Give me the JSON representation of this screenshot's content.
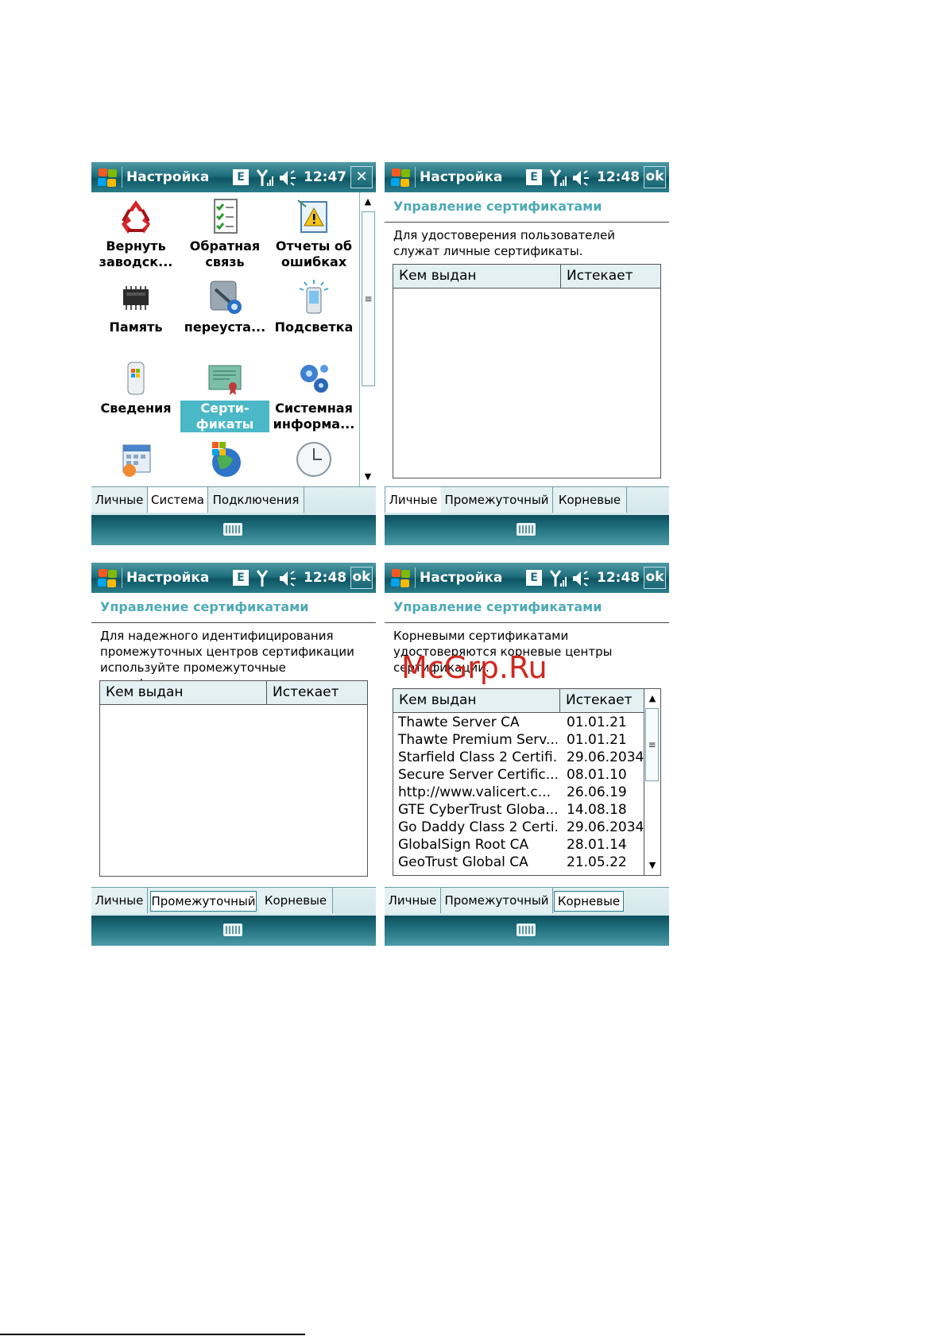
{
  "status": {
    "app_title": "Настройка",
    "network_badge": "E",
    "time_1": "12:47",
    "time_2": "12:48",
    "ok_label": "ok",
    "close_label": "✕"
  },
  "system": {
    "items": [
      {
        "label": "Вернуть заводск...",
        "icon": "recycle-icon"
      },
      {
        "label": "Обратная связь",
        "icon": "checklist-icon"
      },
      {
        "label": "Отчеты об ошибках",
        "icon": "error-report-icon"
      },
      {
        "label": "Память",
        "icon": "memory-chip-icon"
      },
      {
        "label": "переуста...",
        "icon": "reinstall-icon"
      },
      {
        "label": "Подсветка",
        "icon": "backlight-icon"
      },
      {
        "label": "Сведения",
        "icon": "device-info-icon"
      },
      {
        "label": "Серти-фикаты",
        "icon": "certificate-icon"
      },
      {
        "label": "Системная информа...",
        "icon": "system-info-gears-icon"
      },
      {
        "label": "",
        "icon": "calendar-icon"
      },
      {
        "label": "",
        "icon": "windows-globe-icon"
      },
      {
        "label": "",
        "icon": "clock-icon"
      }
    ],
    "tabs": [
      "Личные",
      "Система",
      "Подключения"
    ]
  },
  "certs": {
    "header": "Управление сертификатами",
    "col_issued": "Кем выдан",
    "col_expires": "Истекает",
    "tabs": [
      "Личные",
      "Промежуточный",
      "Корневые"
    ],
    "personal_desc": "Для удостоверения пользователей служат личные сертификаты.",
    "intermediate_desc": "Для надежного идентифицирования промежуточных центров сертификации используйте промежуточные сертификаты.",
    "root_desc": "Корневыми сертификатами удостоверяются корневые центры сертификации.",
    "root_rows": [
      {
        "issuer": "Thawte Server CA",
        "expires": "01.01.21"
      },
      {
        "issuer": "Thawte Premium Serv...",
        "expires": "01.01.21"
      },
      {
        "issuer": "Starfield Class 2 Certifi...",
        "expires": "29.06.2034"
      },
      {
        "issuer": "Secure Server Certific...",
        "expires": "08.01.10"
      },
      {
        "issuer": "http://www.valicert.c...",
        "expires": "26.06.19"
      },
      {
        "issuer": "GTE CyberTrust Globa...",
        "expires": "14.08.18"
      },
      {
        "issuer": "Go Daddy Class 2 Certi...",
        "expires": "29.06.2034"
      },
      {
        "issuer": "GlobalSign Root CA",
        "expires": "28.01.14"
      },
      {
        "issuer": "GeoTrust Global CA",
        "expires": "21.05.22"
      }
    ]
  },
  "watermark": "McGrp.Ru",
  "colors": {
    "titlebar": "#1f6e7c",
    "header_text": "#4eaab6",
    "selection": "#4bb8c8",
    "watermark": "#d0271f"
  }
}
